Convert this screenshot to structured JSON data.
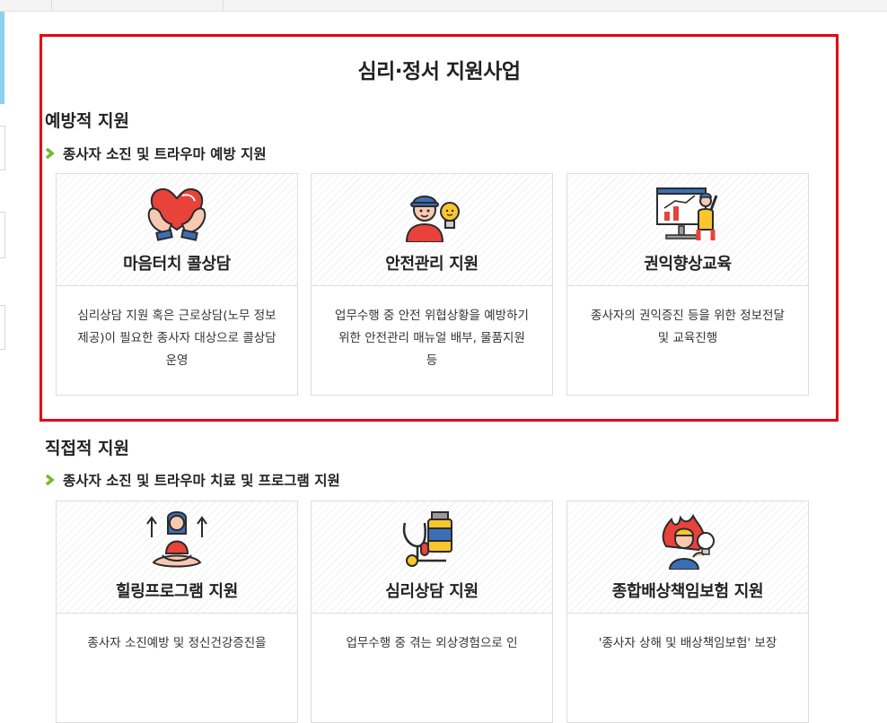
{
  "page": {
    "title": "심리·정서 지원사업"
  },
  "preventive": {
    "section_title": "예방적 지원",
    "sub_title": "종사자 소진 및 트라우마 예방 지원",
    "cards": [
      {
        "title": "마음터치 콜상담",
        "desc": "심리상담 지원 혹은 근로상담(노무 정보제공)이 필요한 종사자 대상으로 콜상담 운영",
        "icon": "heart-hands-icon"
      },
      {
        "title": "안전관리 지원",
        "desc": "업무수행 중 안전 위협상황을 예방하기 위한 안전관리 매뉴얼 배부, 물품지원 등",
        "icon": "worker-lightbulb-icon"
      },
      {
        "title": "권익향상교육",
        "desc": "종사자의 권익증진 등을 위한 정보전달 및 교육진행",
        "icon": "presentation-icon"
      }
    ]
  },
  "direct": {
    "section_title": "직접적 지원",
    "sub_title": "종사자 소진 및 트라우마 치료 및 프로그램 지원",
    "cards": [
      {
        "title": "힐링프로그램 지원",
        "desc": "종사자 소진예방 및 정신건강증진을",
        "icon": "meditation-icon"
      },
      {
        "title": "심리상담 지원",
        "desc": "업무수행 중 겪는 외상경험으로 인",
        "icon": "medicine-stethoscope-icon"
      },
      {
        "title": "종합배상책임보험 지원",
        "desc": "'종사자 상해 및 배상책임보험' 보장",
        "icon": "stress-person-icon"
      }
    ]
  },
  "colors": {
    "highlight": "#e60012",
    "bullet": "#76b82a",
    "left_accent": "#8fd0f0"
  }
}
